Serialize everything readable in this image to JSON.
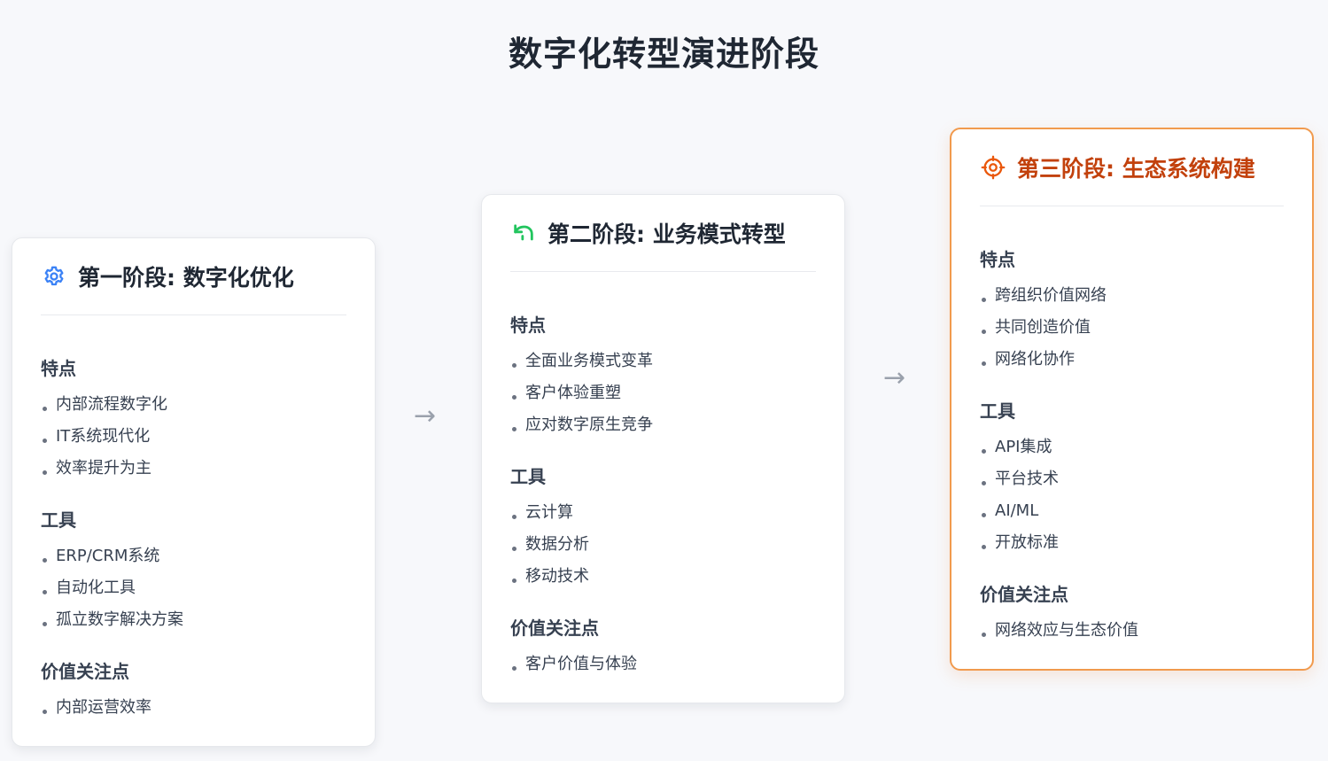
{
  "title": "数字化转型演进阶段",
  "arrow_glyph": "→",
  "stages": [
    {
      "icon": "gear-icon",
      "icon_color": "#3b82f6",
      "title": "第一阶段: 数字化优化",
      "sections": [
        {
          "heading": "特点",
          "items": [
            "内部流程数字化",
            "IT系统现代化",
            "效率提升为主"
          ]
        },
        {
          "heading": "工具",
          "items": [
            "ERP/CRM系统",
            "自动化工具",
            "孤立数字解决方案"
          ]
        },
        {
          "heading": "价值关注点",
          "items": [
            "内部运营效率"
          ]
        }
      ]
    },
    {
      "icon": "undo-arrow-icon",
      "icon_color": "#22c55e",
      "title": "第二阶段: 业务模式转型",
      "sections": [
        {
          "heading": "特点",
          "items": [
            "全面业务模式变革",
            "客户体验重塑",
            "应对数字原生竞争"
          ]
        },
        {
          "heading": "工具",
          "items": [
            "云计算",
            "数据分析",
            "移动技术"
          ]
        },
        {
          "heading": "价值关注点",
          "items": [
            "客户价值与体验"
          ]
        }
      ]
    },
    {
      "icon": "target-icon",
      "icon_color": "#ea580c",
      "title": "第三阶段: 生态系统构建",
      "sections": [
        {
          "heading": "特点",
          "items": [
            "跨组织价值网络",
            "共同创造价值",
            "网络化协作"
          ]
        },
        {
          "heading": "工具",
          "items": [
            "API集成",
            "平台技术",
            "AI/ML",
            "开放标准"
          ]
        },
        {
          "heading": "价值关注点",
          "items": [
            "网络效应与生态价值"
          ]
        }
      ]
    }
  ]
}
